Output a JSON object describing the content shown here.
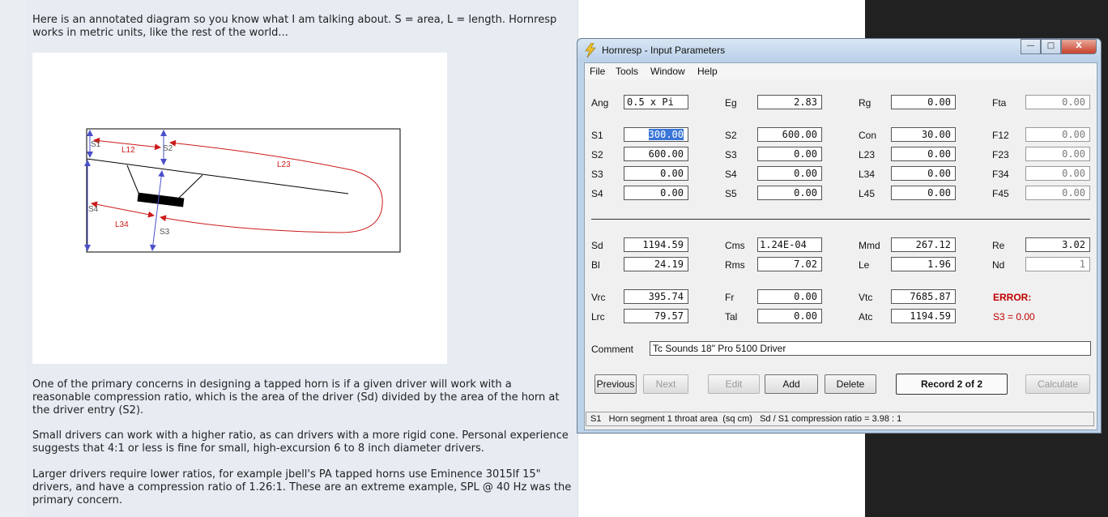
{
  "post": {
    "intro": "Here is an annotated diagram so you know what I am talking about. S = area, L = length. Hornresp works in metric units, like the rest of the world...",
    "p1": "One of the primary concerns in designing a tapped horn is if a given driver will work with a reasonable compression ratio, which is the area of the driver (Sd) divided by the area of the horn at the driver entry (S2).",
    "p2": "Small drivers can work with a higher ratio, as can drivers with a more rigid cone. Personal experience suggests that 4:1 or less is fine for small, high-excursion 6 to 8 inch diameter drivers.",
    "p3": "Larger drivers require lower ratios, for example jbell's PA tapped horns use Eminence 3015lf 15\" drivers, and have a compression ratio of 1.26:1. These are an extreme example, SPL @ 40 Hz was the primary concern."
  },
  "diagram": {
    "labels": {
      "s1": "S1",
      "s2": "S2",
      "s3": "S3",
      "s4": "S4",
      "l12": "L12",
      "l23": "L23",
      "l34": "L34"
    },
    "colors": {
      "blue": "#4a50c8",
      "red": "#cc1a1a"
    }
  },
  "window": {
    "title": "Hornresp - Input Parameters",
    "icon": "lightning-icon",
    "controls": {
      "min": "—",
      "max": "□",
      "close": "X"
    },
    "menu": [
      "File",
      "Tools",
      "Window",
      "Help"
    ],
    "row_top": [
      {
        "label": "Ang",
        "value": "0.5 x Pi"
      },
      {
        "label": "Eg",
        "value": "2.83"
      },
      {
        "label": "Rg",
        "value": "0.00"
      },
      {
        "label": "Fta",
        "value": "0.00"
      }
    ],
    "grid": [
      [
        {
          "label": "S1",
          "value": "300.00"
        },
        {
          "label": "S2",
          "value": "600.00"
        },
        {
          "label": "Con",
          "value": "30.00"
        },
        {
          "label": "F12",
          "value": "0.00"
        }
      ],
      [
        {
          "label": "S2",
          "value": "600.00"
        },
        {
          "label": "S3",
          "value": "0.00"
        },
        {
          "label": "L23",
          "value": "0.00"
        },
        {
          "label": "F23",
          "value": "0.00"
        }
      ],
      [
        {
          "label": "S3",
          "value": "0.00"
        },
        {
          "label": "S4",
          "value": "0.00"
        },
        {
          "label": "L34",
          "value": "0.00"
        },
        {
          "label": "F34",
          "value": "0.00"
        }
      ],
      [
        {
          "label": "S4",
          "value": "0.00"
        },
        {
          "label": "S5",
          "value": "0.00"
        },
        {
          "label": "L45",
          "value": "0.00"
        },
        {
          "label": "F45",
          "value": "0.00"
        }
      ]
    ],
    "driver1": [
      [
        {
          "label": "Sd",
          "value": "1194.59"
        },
        {
          "label": "Cms",
          "value": "1.24E-04"
        },
        {
          "label": "Mmd",
          "value": "267.12"
        },
        {
          "label": "Re",
          "value": "3.02"
        }
      ],
      [
        {
          "label": "Bl",
          "value": "24.19"
        },
        {
          "label": "Rms",
          "value": "7.02"
        },
        {
          "label": "Le",
          "value": "1.96"
        },
        {
          "label": "Nd",
          "value": "1"
        }
      ]
    ],
    "driver2": [
      [
        {
          "label": "Vrc",
          "value": "395.74"
        },
        {
          "label": "Fr",
          "value": "0.00"
        },
        {
          "label": "Vtc",
          "value": "7685.87"
        }
      ],
      [
        {
          "label": "Lrc",
          "value": "79.57"
        },
        {
          "label": "Tal",
          "value": "0.00"
        },
        {
          "label": "Atc",
          "value": "1194.59"
        }
      ]
    ],
    "error_title": "ERROR:",
    "error_msg": "S3 = 0.00",
    "comment_label": "Comment",
    "comment_value": "Tc Sounds 18\" Pro 5100 Driver",
    "buttons": {
      "previous": "Previous",
      "next": "Next",
      "edit": "Edit",
      "add": "Add",
      "delete": "Delete",
      "record": "Record 2 of 2",
      "calculate": "Calculate"
    },
    "status": "S1   Horn segment 1 throat area  (sq cm)   Sd / S1 compression ratio = 3.98 : 1",
    "error_color": "#c00000"
  }
}
